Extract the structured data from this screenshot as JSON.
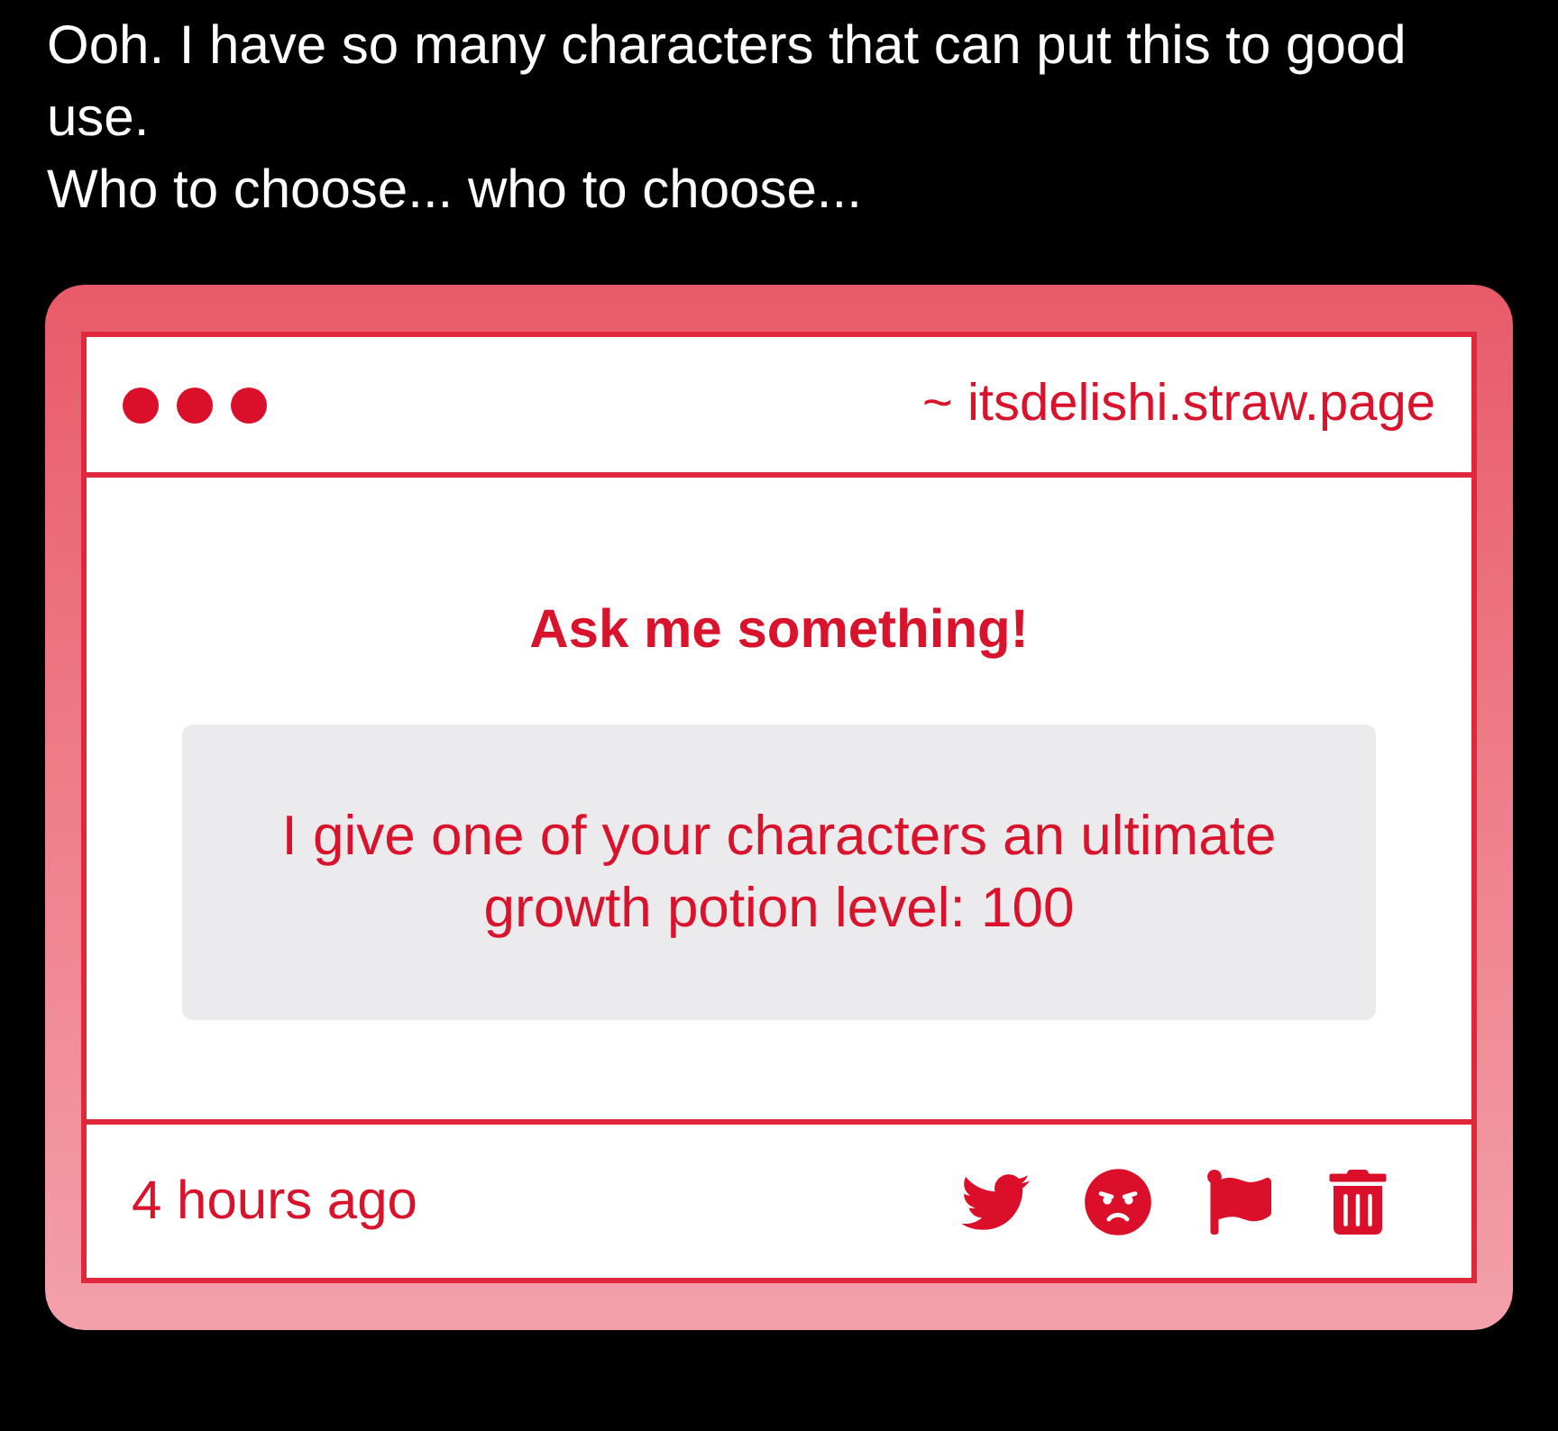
{
  "post": {
    "text_lines": [
      "Ooh. I have so many characters that can put this to good use.",
      "Who to choose... who to choose..."
    ]
  },
  "card": {
    "url": "~ itsdelishi.straw.page",
    "heading": "Ask me something!",
    "question": "I give one of your characters an ultimate growth potion level: 100",
    "time": "4 hours ago"
  }
}
